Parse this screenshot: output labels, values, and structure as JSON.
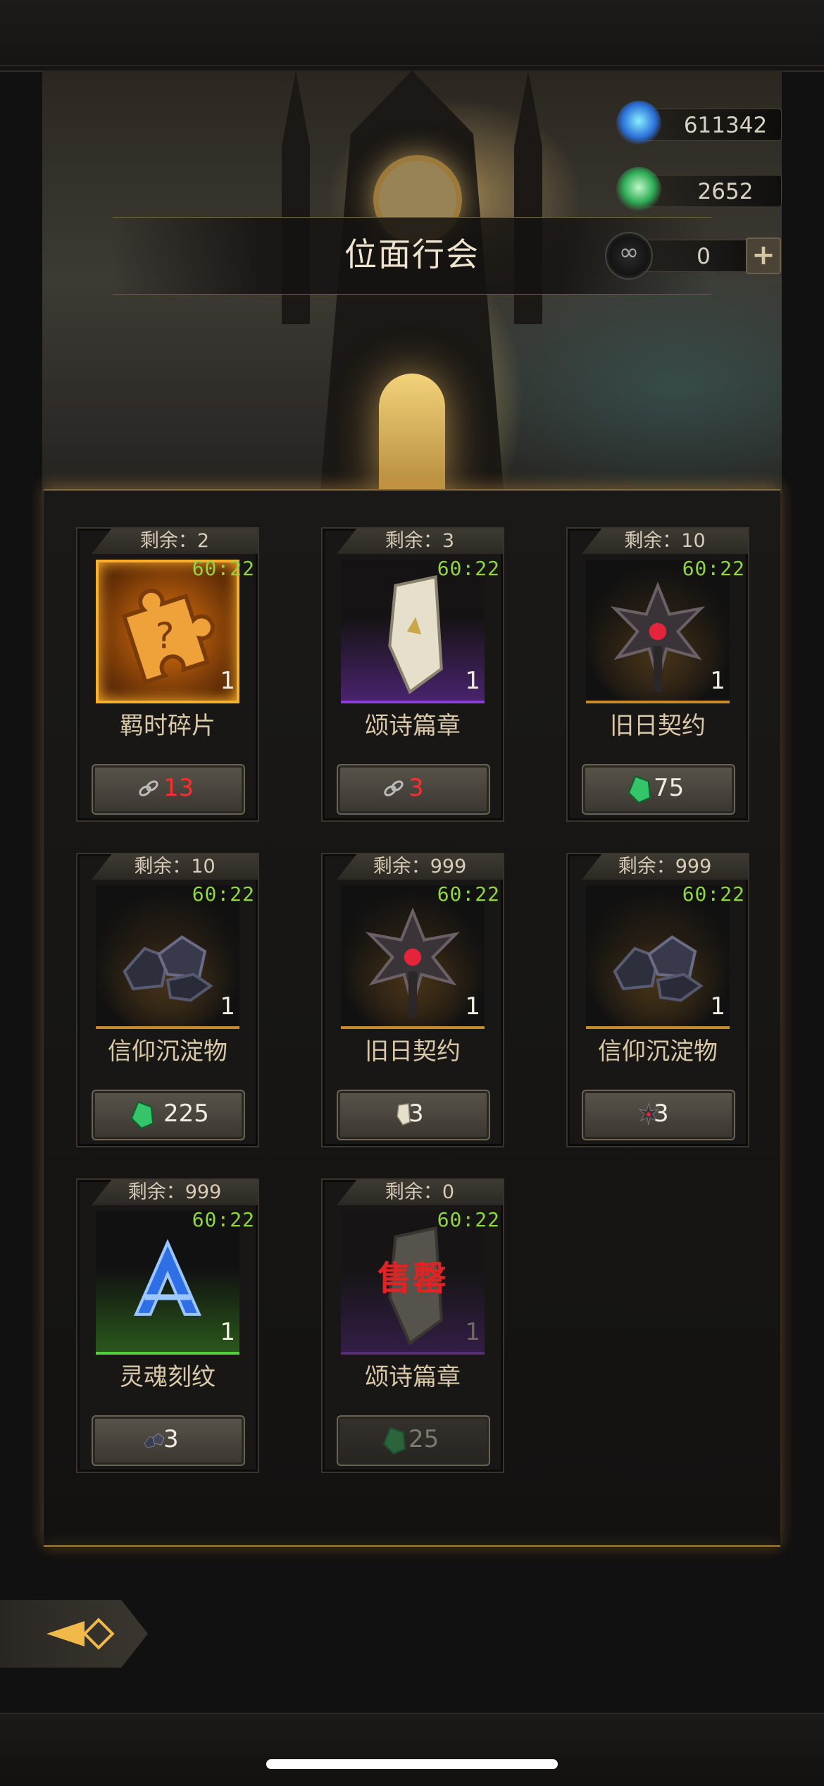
{
  "header": {
    "title": "位面行会"
  },
  "currencies": [
    {
      "icon": "soul-flame-icon",
      "value": "611342"
    },
    {
      "icon": "green-gem-icon",
      "value": "2652"
    },
    {
      "icon": "chain-link-icon",
      "value": "0",
      "add_label": "+"
    }
  ],
  "shop": {
    "items": [
      {
        "remaining": "剩余：2",
        "timer": "60:22",
        "qty": "1",
        "name": "羁时碎片",
        "price": "13",
        "price_icon": "chain-link-icon",
        "price_color": "#ff2d2d",
        "frame": "orange",
        "item_icon": "puzzle-piece-icon"
      },
      {
        "remaining": "剩余：3",
        "timer": "60:22",
        "qty": "1",
        "name": "颂诗篇章",
        "price": "3",
        "price_icon": "chain-link-icon",
        "price_color": "#ff2d2d",
        "frame": "purple",
        "item_icon": "scroll-page-icon"
      },
      {
        "remaining": "剩余：10",
        "timer": "60:22",
        "qty": "1",
        "name": "旧日契约",
        "price": "75",
        "price_icon": "green-gem-icon",
        "frame": "gold",
        "item_icon": "dark-star-icon"
      },
      {
        "remaining": "剩余：10",
        "timer": "60:22",
        "qty": "1",
        "name": "信仰沉淀物",
        "price": "225",
        "price_icon": "green-gem-icon",
        "frame": "gold",
        "item_icon": "ore-rocks-icon"
      },
      {
        "remaining": "剩余：999",
        "timer": "60:22",
        "qty": "1",
        "name": "旧日契约",
        "price": "3",
        "price_icon": "scroll-page-icon",
        "frame": "gold",
        "item_icon": "dark-star-icon"
      },
      {
        "remaining": "剩余：999",
        "timer": "60:22",
        "qty": "1",
        "name": "信仰沉淀物",
        "price": "3",
        "price_icon": "dark-star-icon",
        "frame": "gold",
        "item_icon": "ore-rocks-icon"
      },
      {
        "remaining": "剩余：999",
        "timer": "60:22",
        "qty": "1",
        "name": "灵魂刻纹",
        "price": "3",
        "price_icon": "ore-rocks-icon",
        "frame": "green",
        "item_icon": "soul-rune-icon"
      },
      {
        "remaining": "剩余：0",
        "timer": "60:22",
        "qty": "1",
        "name": "颂诗篇章",
        "price": "25",
        "price_icon": "green-gem-icon",
        "frame": "purple",
        "item_icon": "scroll-page-icon",
        "sold_out": "售罄"
      }
    ]
  },
  "colors": {
    "timer": "#8fd63f",
    "accent_gold": "#f1b84a",
    "sold_out": "#e02323"
  }
}
